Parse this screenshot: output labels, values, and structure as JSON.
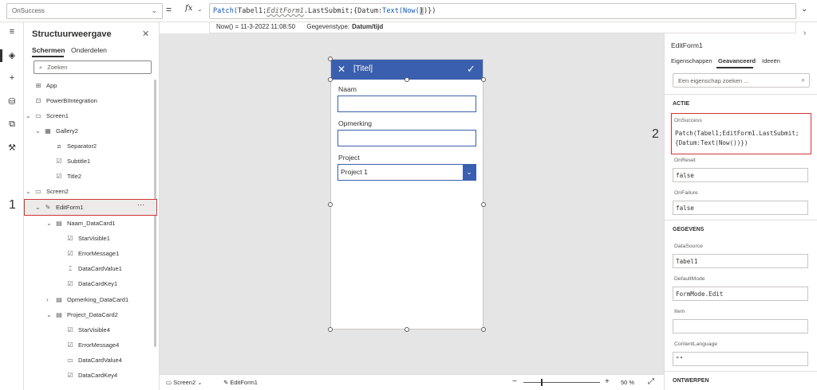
{
  "formula_bar": {
    "property": "OnSuccess",
    "func_patch": "Patch(",
    "ref_tabel": "Tabel1",
    "sep1": ";",
    "ref_editform": "EditForm1",
    "dot_last": ".LastSubmit;{Datum:",
    "func_text": "Text(",
    "func_now": "Now(",
    "cursor_paren": ")",
    "tail": ")})",
    "hint_value": "Now()  =  11-3-2022 11:08:50",
    "hint_type_label": "Gegevenstype:",
    "hint_type_value": "Datum/tijd"
  },
  "tree": {
    "title": "Structuurweergave",
    "tab_screens": "Schermen",
    "tab_components": "Onderdelen",
    "search_placeholder": "Zoeken",
    "nodes": {
      "app": "App",
      "powerbi": "PowerBIIntegration",
      "screen1": "Screen1",
      "gallery2": "Gallery2",
      "separator2": "Separator2",
      "subtitle1": "Subtitle1",
      "title2": "Title2",
      "screen2": "Screen2",
      "editform1": "EditForm1",
      "naam_datacard1": "Naam_DataCard1",
      "starvisible1": "StarVisible1",
      "errormessage1": "ErrorMessage1",
      "datacardvalue1": "DataCardValue1",
      "datacardkey1": "DataCardKey1",
      "opmerking_datacard1": "Opmerking_DataCard1",
      "project_datacard2": "Project_DataCard2",
      "starvisible4": "StarVisible4",
      "errormessage4": "ErrorMessage4",
      "datacardvalue4": "DataCardValue4",
      "datacardkey4": "DataCardKey4"
    },
    "dots": "···"
  },
  "annotations": {
    "one": "1",
    "two": "2"
  },
  "form": {
    "title": "[Titel]",
    "label_naam": "Naam",
    "label_opmerking": "Opmerking",
    "label_project": "Project",
    "project_value": "Project 1"
  },
  "statusbar": {
    "screen": "Screen2",
    "control": "EditForm1",
    "zoom": "50  %"
  },
  "props": {
    "control_name": "EditForm1",
    "tab_properties": "Eigenschappen",
    "tab_advanced": "Geavanceerd",
    "tab_ideas": "Ideeën",
    "search_placeholder": "Een eigenschap zoeken ...",
    "section_action": "ACTIE",
    "section_data": "GEGEVENS",
    "section_design": "ONTWERPEN",
    "onsuccess_name": "OnSuccess",
    "onsuccess_value": "Patch(Tabel1;EditForm1.LastSubmit;\n{Datum:Text(Now())})",
    "onreset_name": "OnReset",
    "onreset_value": "false",
    "onfailure_name": "OnFailure",
    "onfailure_value": "false",
    "datasource_name": "DataSource",
    "datasource_value": "Tabel1",
    "defaultmode_name": "DefaultMode",
    "defaultmode_value": "FormMode.Edit",
    "item_name": "Item",
    "item_value": "",
    "contentlanguage_name": "ContentLanguage",
    "contentlanguage_value": "\"\""
  },
  "colors": {
    "accent": "#3a5fae",
    "highlight": "#d13438"
  }
}
